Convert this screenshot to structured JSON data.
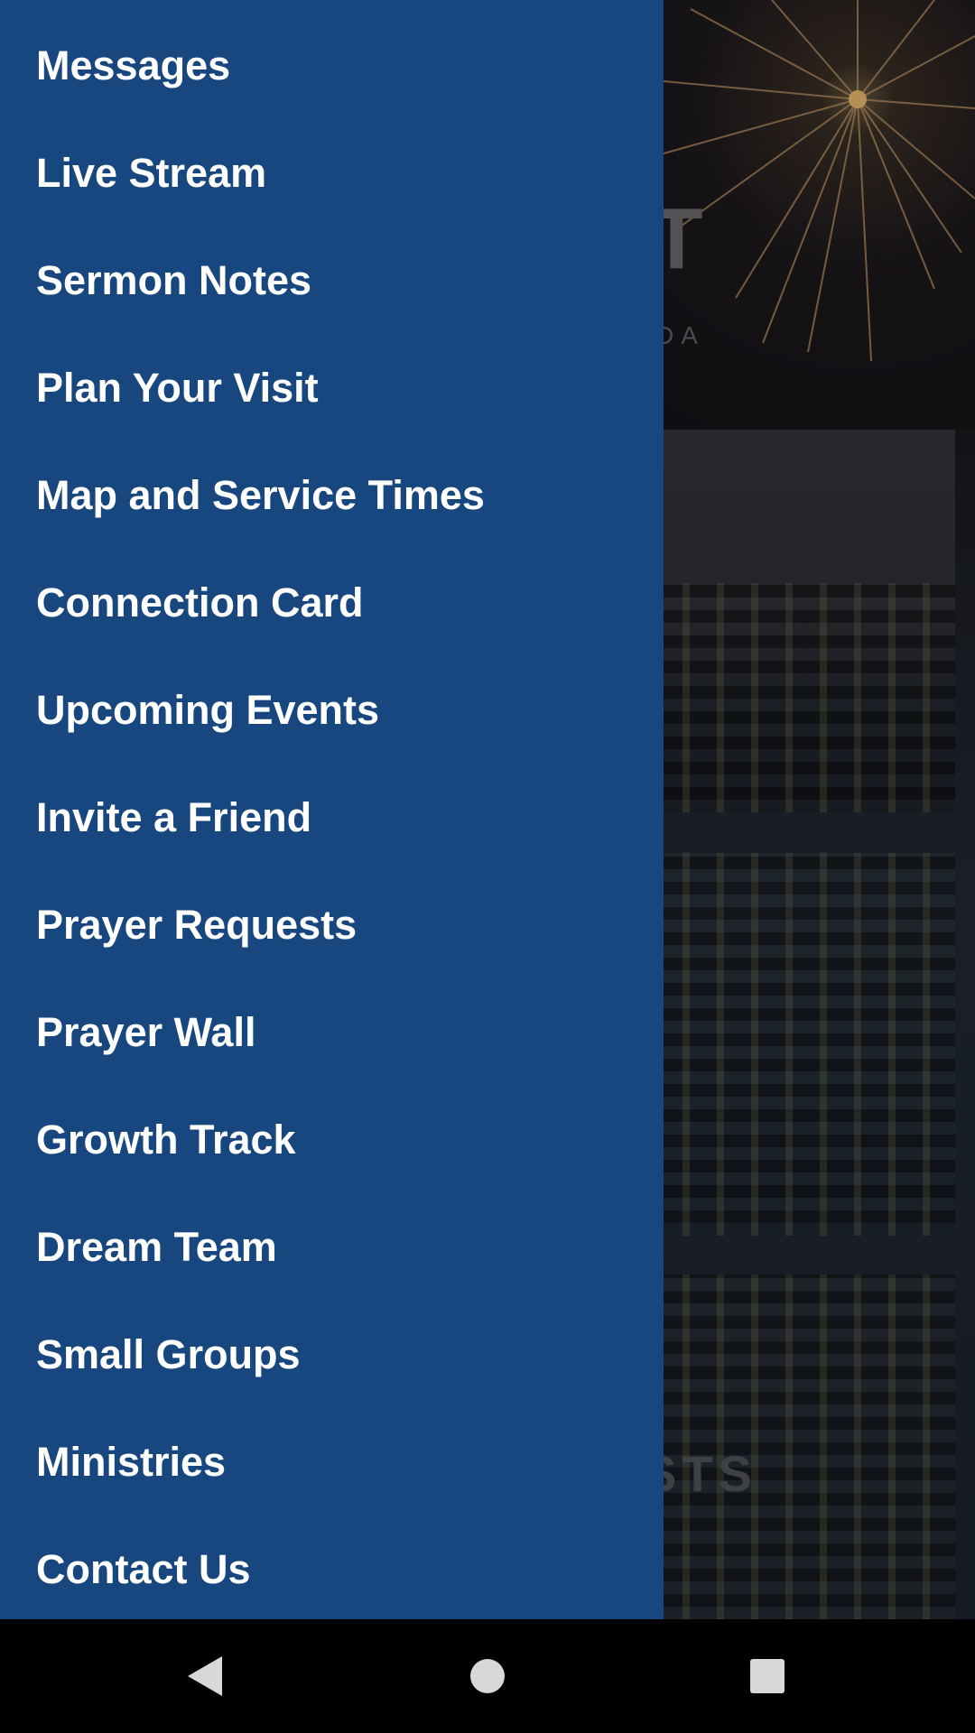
{
  "background": {
    "hero_letter": "T",
    "hero_subtitle": "DA",
    "card3_text": "STS"
  },
  "drawer": {
    "items": [
      {
        "label": "Messages"
      },
      {
        "label": "Live Stream"
      },
      {
        "label": "Sermon Notes"
      },
      {
        "label": "Plan Your Visit"
      },
      {
        "label": "Map and Service Times"
      },
      {
        "label": "Connection Card"
      },
      {
        "label": "Upcoming Events"
      },
      {
        "label": "Invite a Friend"
      },
      {
        "label": "Prayer Requests"
      },
      {
        "label": "Prayer Wall"
      },
      {
        "label": "Growth Track"
      },
      {
        "label": "Dream Team"
      },
      {
        "label": "Small Groups"
      },
      {
        "label": "Ministries"
      },
      {
        "label": "Contact Us"
      }
    ]
  },
  "navbar": {
    "back_icon": "back-triangle-icon",
    "home_icon": "home-circle-icon",
    "recents_icon": "recents-square-icon"
  },
  "colors": {
    "drawer_bg": "#17477e",
    "menu_text": "#ffffff",
    "navbar_bg": "#000000"
  }
}
